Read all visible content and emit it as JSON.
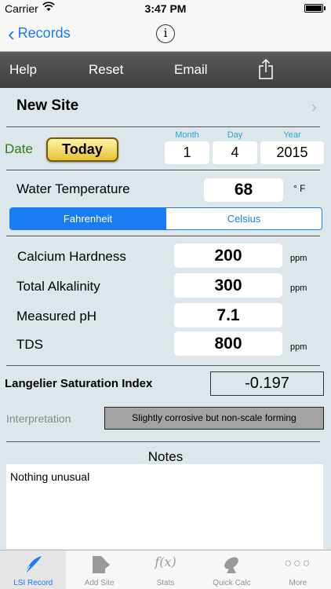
{
  "status": {
    "carrier": "Carrier",
    "time": "3:47 PM"
  },
  "nav": {
    "back_label": "Records",
    "info_icon": "info-icon"
  },
  "toolbar": {
    "help": "Help",
    "reset": "Reset",
    "email": "Email",
    "share_icon": "share-icon"
  },
  "site": {
    "name": "New Site"
  },
  "date": {
    "label": "Date",
    "today_button": "Today",
    "month_label": "Month",
    "month": "1",
    "day_label": "Day",
    "day": "4",
    "year_label": "Year",
    "year": "2015"
  },
  "temperature": {
    "label": "Water Temperature",
    "value": "68",
    "unit": "° F"
  },
  "unit_toggle": {
    "fahrenheit": "Fahrenheit",
    "celsius": "Celsius",
    "selected": "Fahrenheit"
  },
  "measurements": {
    "calcium": {
      "label": "Calcium Hardness",
      "value": "200",
      "unit": "ppm"
    },
    "alkalinity": {
      "label": "Total Alkalinity",
      "value": "300",
      "unit": "ppm"
    },
    "ph": {
      "label": "Measured pH",
      "value": "7.1"
    },
    "tds": {
      "label": "TDS",
      "value": "800",
      "unit": "ppm"
    }
  },
  "lsi": {
    "label": "Langelier Saturation Index",
    "value": "-0.197"
  },
  "interpretation": {
    "label": "Interpretation",
    "value": "Slightly corrosive but non-scale forming"
  },
  "notes": {
    "title": "Notes",
    "text": "Nothing unusual"
  },
  "tabs": [
    {
      "label": "LSI Record",
      "active": true
    },
    {
      "label": "Add Site"
    },
    {
      "label": "Stats"
    },
    {
      "label": "Quick Calc"
    },
    {
      "label": "More"
    }
  ],
  "colors": {
    "accent": "#1a7cf5",
    "date_label": "#2f7d15",
    "date_header": "#27a6d8",
    "background": "#dde6ea"
  }
}
